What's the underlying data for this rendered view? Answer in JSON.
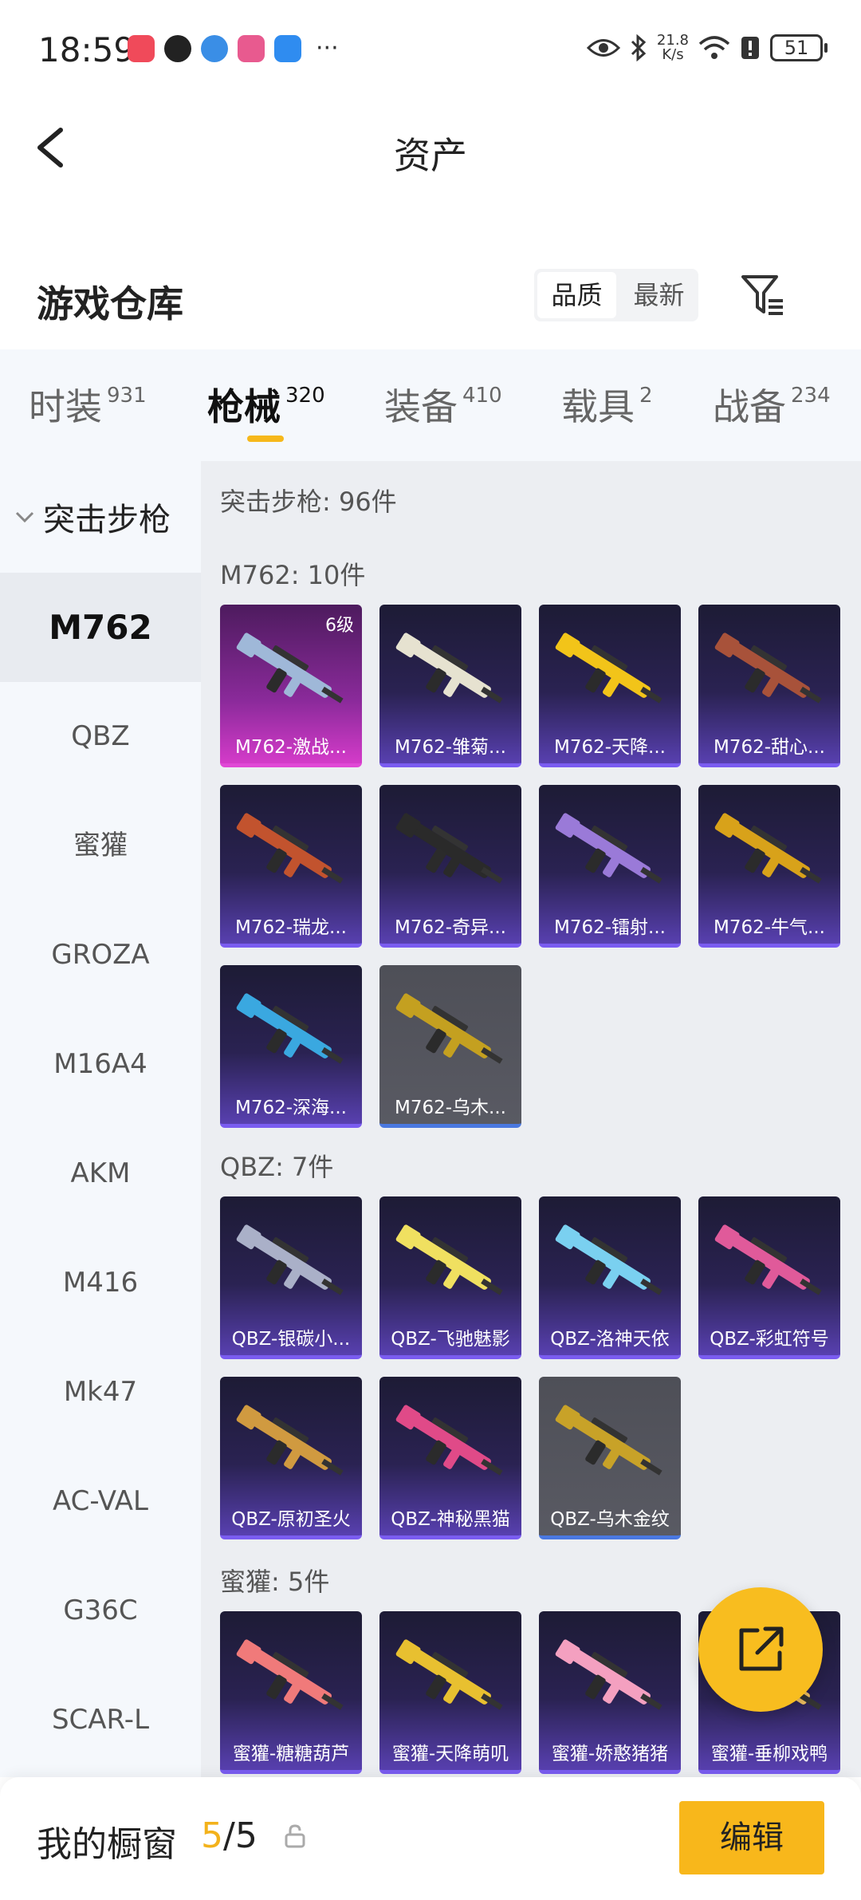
{
  "status": {
    "time": "18:59",
    "speed_top": "21.8",
    "speed_bottom": "K/s",
    "battery": "51",
    "more": "···"
  },
  "header": {
    "title": "资产"
  },
  "section": {
    "title": "游戏仓库",
    "sort_quality": "品质",
    "sort_latest": "最新"
  },
  "tabs": [
    {
      "label": "时装",
      "count": "931"
    },
    {
      "label": "枪械",
      "count": "320"
    },
    {
      "label": "装备",
      "count": "410"
    },
    {
      "label": "载具",
      "count": "2"
    },
    {
      "label": "战备",
      "count": "234"
    }
  ],
  "leftnav": {
    "category": "突击步枪",
    "items": [
      "M762",
      "QBZ",
      "蜜獾",
      "GROZA",
      "M16A4",
      "AKM",
      "M416",
      "Mk47",
      "AC-VAL",
      "G36C",
      "SCAR-L"
    ]
  },
  "content": {
    "summary": "突击步枪: 96件",
    "groups": [
      {
        "title": "M762: 10件",
        "items": [
          {
            "name": "M762-激战...",
            "level": "6级"
          },
          {
            "name": "M762-雏菊..."
          },
          {
            "name": "M762-天降..."
          },
          {
            "name": "M762-甜心..."
          },
          {
            "name": "M762-瑞龙..."
          },
          {
            "name": "M762-奇异..."
          },
          {
            "name": "M762-镭射..."
          },
          {
            "name": "M762-牛气..."
          },
          {
            "name": "M762-深海..."
          },
          {
            "name": "M762-乌木..."
          }
        ]
      },
      {
        "title": "QBZ: 7件",
        "items": [
          {
            "name": "QBZ-银碳小..."
          },
          {
            "name": "QBZ-飞驰魅影"
          },
          {
            "name": "QBZ-洛神天依"
          },
          {
            "name": "QBZ-彩虹符号"
          },
          {
            "name": "QBZ-原初圣火"
          },
          {
            "name": "QBZ-神秘黑猫"
          },
          {
            "name": "QBZ-乌木金纹"
          }
        ]
      },
      {
        "title": "蜜獾: 5件",
        "items": [
          {
            "name": "蜜獾-糖糖葫芦"
          },
          {
            "name": "蜜獾-天降萌叽"
          },
          {
            "name": "蜜獾-娇憨猪猪"
          },
          {
            "name": "蜜獾-垂柳戏鸭"
          }
        ]
      }
    ]
  },
  "bottom": {
    "label": "我的橱窗",
    "current": "5",
    "total": "/5",
    "edit": "编辑"
  },
  "colors": {
    "accent": "#f8b71b",
    "purple_card": "#5840b0",
    "rare_card": "#d43bc9"
  }
}
